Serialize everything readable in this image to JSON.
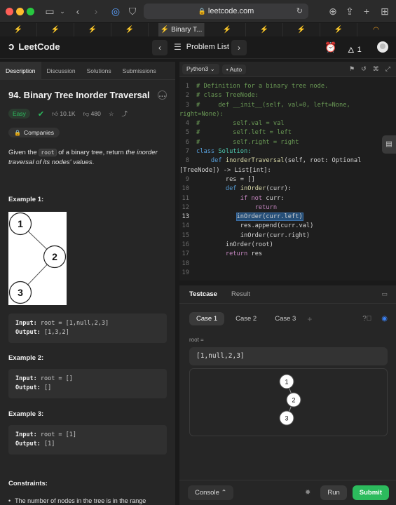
{
  "browser": {
    "url": "leetcode.com",
    "active_tab": "Binary T..."
  },
  "header": {
    "logo": "LeetCode",
    "problem_list": "Problem List",
    "streak_count": "1"
  },
  "left_tabs": [
    "Description",
    "Discussion",
    "Solutions",
    "Submissions"
  ],
  "problem": {
    "title": "94. Binary Tree Inorder Traversal",
    "difficulty": "Easy",
    "likes": "10.1K",
    "dislikes": "480",
    "companies": "Companies",
    "desc_pre": "Given the ",
    "desc_code": "root",
    "desc_mid": " of a binary tree, return ",
    "desc_em": "the inorder traversal of its nodes' values",
    "desc_end": "."
  },
  "examples": [
    {
      "title": "Example 1:",
      "input_label": "Input:",
      "input": "root = [1,null,2,3]",
      "output_label": "Output:",
      "output": "[1,3,2]"
    },
    {
      "title": "Example 2:",
      "input_label": "Input:",
      "input": "root = []",
      "output_label": "Output:",
      "output": "[]"
    },
    {
      "title": "Example 3:",
      "input_label": "Input:",
      "input": "root = [1]",
      "output_label": "Output:",
      "output": "[1]"
    }
  ],
  "example_tree": {
    "nodes": [
      "1",
      "2",
      "3"
    ]
  },
  "constraints": {
    "title": "Constraints:",
    "item1": "The number of nodes in the tree is in the range"
  },
  "editor": {
    "language": "Python3",
    "mode": "Auto",
    "line_numbers": [
      "1",
      "2",
      "3",
      "4",
      "5",
      "6",
      "7",
      "8",
      "9",
      "10",
      "11",
      "12",
      "13",
      "14",
      "15",
      "16",
      "17",
      "18",
      "19"
    ],
    "line1": "# Definition for a binary tree node.",
    "line2": "# class TreeNode:",
    "line3a": "#     def __init__(self, val=0, left=None,",
    "line3b": "right=None):",
    "line4": "#         self.val = val",
    "line5": "#         self.left = left",
    "line6": "#         self.right = right",
    "line7_kw": "class",
    "line7_name": " Solution:",
    "line8_indent": "    ",
    "line8_kw": "def",
    "line8_fn": " inorderTraversal",
    "line8_rest": "(self, root: Optional",
    "line8b": "[TreeNode]) -> List[int]:",
    "line9": "        res = []",
    "line10_indent": "        ",
    "line10_kw": "def",
    "line10_fn": " inOrder",
    "line10_rest": "(curr):",
    "line11_indent": "            ",
    "line11_kw": "if not",
    "line11_rest": " curr:",
    "line12_indent": "                ",
    "line12_kw": "return",
    "line13_indent": "           ",
    "line13_sel": "inOrder(curr.left)",
    "line14": "            res.append(curr.val)",
    "line15": "            inOrder(curr.right)",
    "line16": "        inOrder(root)",
    "line17_indent": "        ",
    "line17_kw": "return",
    "line17_rest": " res"
  },
  "testcase": {
    "tab_testcase": "Testcase",
    "tab_result": "Result",
    "cases": [
      "Case 1",
      "Case 2",
      "Case 3"
    ],
    "root_label": "root =",
    "root_value": "[1,null,2,3]",
    "tree_nodes": [
      "1",
      "2",
      "3"
    ]
  },
  "bottom": {
    "console": "Console",
    "run": "Run",
    "submit": "Submit"
  }
}
